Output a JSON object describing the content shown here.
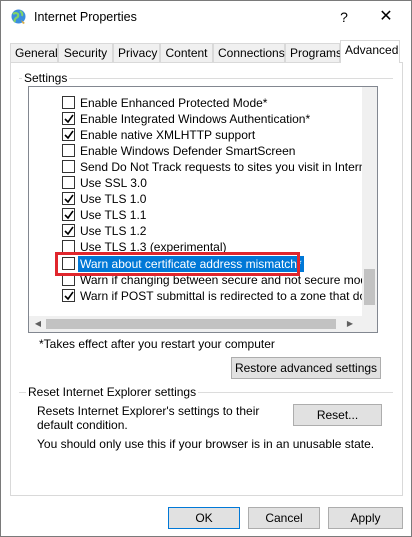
{
  "window": {
    "title": "Internet Properties",
    "help_glyph": "?",
    "close_glyph": "✕"
  },
  "tabs": [
    {
      "label": "General",
      "active": false
    },
    {
      "label": "Security",
      "active": false
    },
    {
      "label": "Privacy",
      "active": false
    },
    {
      "label": "Content",
      "active": false
    },
    {
      "label": "Connections",
      "active": false
    },
    {
      "label": "Programs",
      "active": false
    },
    {
      "label": "Advanced",
      "active": true
    }
  ],
  "settings_group": {
    "label": "Settings",
    "items": [
      {
        "label": "Enable Enhanced Protected Mode*",
        "checked": false,
        "selected": false
      },
      {
        "label": "Enable Integrated Windows Authentication*",
        "checked": true,
        "selected": false
      },
      {
        "label": "Enable native XMLHTTP support",
        "checked": true,
        "selected": false
      },
      {
        "label": "Enable Windows Defender SmartScreen",
        "checked": false,
        "selected": false
      },
      {
        "label": "Send Do Not Track requests to sites you visit in Internet E",
        "checked": false,
        "selected": false
      },
      {
        "label": "Use SSL 3.0",
        "checked": false,
        "selected": false
      },
      {
        "label": "Use TLS 1.0",
        "checked": true,
        "selected": false
      },
      {
        "label": "Use TLS 1.1",
        "checked": true,
        "selected": false
      },
      {
        "label": "Use TLS 1.2",
        "checked": true,
        "selected": false
      },
      {
        "label": "Use TLS 1.3 (experimental)",
        "checked": false,
        "selected": false
      },
      {
        "label": "Warn about certificate address mismatch*",
        "checked": false,
        "selected": true
      },
      {
        "label": "Warn if changing between secure and not secure mode",
        "checked": false,
        "selected": false
      },
      {
        "label": "Warn if POST submittal is redirected to a zone that does n",
        "checked": true,
        "selected": false
      }
    ],
    "note": "*Takes effect after you restart your computer",
    "restore_button": "Restore advanced settings"
  },
  "reset_group": {
    "label": "Reset Internet Explorer settings",
    "description": "Resets Internet Explorer's settings to their default condition.",
    "reset_button": "Reset...",
    "warning": "You should only use this if your browser is in an unusable state."
  },
  "dialog_buttons": {
    "ok": "OK",
    "cancel": "Cancel",
    "apply": "Apply"
  },
  "colors": {
    "selection": "#0078d7",
    "highlight_border": "#e0262d",
    "button_face": "#e1e1e1"
  }
}
